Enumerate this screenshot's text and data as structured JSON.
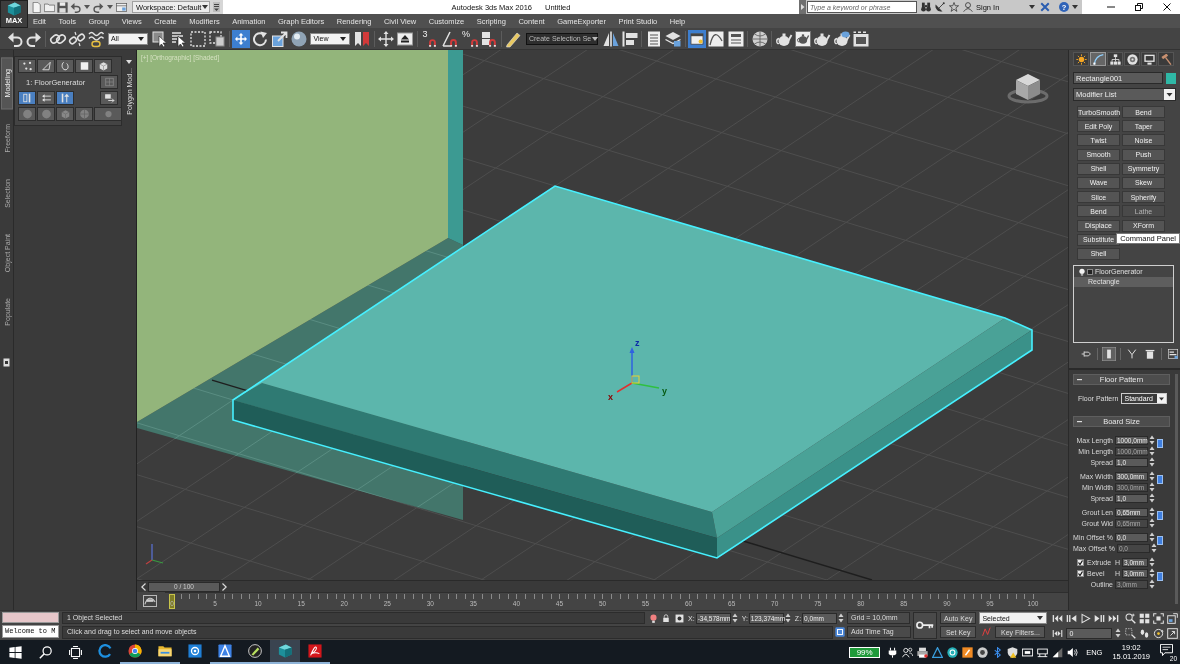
{
  "window": {
    "app_button": "MAX",
    "title": "Autodesk 3ds Max 2016",
    "document": "Untitled"
  },
  "quick_access": {
    "workspace": "Workspace: Default"
  },
  "info_center": {
    "search_placeholder": "Type a keyword or phrase",
    "sign_in": "Sign In",
    "help": "?"
  },
  "menu": [
    "Edit",
    "Tools",
    "Group",
    "Views",
    "Create",
    "Modifiers",
    "Animation",
    "Graph Editors",
    "Rendering",
    "Civil View",
    "Customize",
    "Scripting",
    "Content",
    "GameExporter",
    "Print Studio",
    "Help"
  ],
  "toolbar": [
    {
      "kind": "button",
      "selected": false
    },
    {
      "kind": "button",
      "selected": false
    },
    {
      "kind": "separator"
    },
    {
      "kind": "button",
      "selected": false
    },
    {
      "kind": "button",
      "selected": false
    },
    {
      "kind": "button",
      "selected": false
    },
    {
      "kind": "dropdown",
      "value": "All"
    },
    {
      "kind": "button",
      "selected": false
    },
    {
      "kind": "button",
      "selected": false
    },
    {
      "kind": "button",
      "selected": false
    },
    {
      "kind": "button",
      "selected": false
    },
    {
      "kind": "separator"
    },
    {
      "kind": "button",
      "selected": true
    },
    {
      "kind": "button",
      "selected": false
    },
    {
      "kind": "button",
      "selected": false
    },
    {
      "kind": "button",
      "selected": false
    },
    {
      "kind": "dropdown",
      "value": "View"
    },
    {
      "kind": "button",
      "selected": false
    },
    {
      "kind": "separator"
    },
    {
      "kind": "button",
      "selected": false
    },
    {
      "kind": "button",
      "selected": false
    },
    {
      "kind": "separator"
    },
    {
      "kind": "button",
      "selected": false,
      "label": "3"
    },
    {
      "kind": "button",
      "selected": false
    },
    {
      "kind": "button",
      "selected": false,
      "label": "%"
    },
    {
      "kind": "button",
      "selected": false
    },
    {
      "kind": "separator"
    },
    {
      "kind": "button",
      "selected": false
    },
    {
      "kind": "combo",
      "value": "Create Selection Se"
    },
    {
      "kind": "button",
      "selected": false
    },
    {
      "kind": "button",
      "selected": false
    },
    {
      "kind": "separator"
    },
    {
      "kind": "button",
      "selected": false
    },
    {
      "kind": "button",
      "selected": false
    },
    {
      "kind": "separator"
    },
    {
      "kind": "button",
      "selected": true
    },
    {
      "kind": "button",
      "selected": false
    },
    {
      "kind": "button",
      "selected": false
    },
    {
      "kind": "separator"
    },
    {
      "kind": "button",
      "selected": false
    },
    {
      "kind": "separator"
    },
    {
      "kind": "button",
      "selected": false
    },
    {
      "kind": "button",
      "selected": false
    },
    {
      "kind": "button",
      "selected": false
    },
    {
      "kind": "button",
      "selected": false
    },
    {
      "kind": "button",
      "selected": false
    }
  ],
  "ribbon": {
    "tabs": [
      {
        "label": "Modeling",
        "selected": true
      },
      {
        "label": "Freeform",
        "selected": false
      },
      {
        "label": "Selection",
        "selected": false
      },
      {
        "label": "Object Paint",
        "selected": false
      },
      {
        "label": "Populate",
        "selected": false
      }
    ],
    "subobject_levels": [
      {
        "selected": false
      },
      {
        "selected": false
      },
      {
        "selected": false
      },
      {
        "selected": false
      },
      {
        "selected": false
      }
    ],
    "object": "1: FloorGenerator",
    "tools": [
      {
        "selected": true
      },
      {
        "selected": false
      },
      {
        "selected": true
      }
    ],
    "side_tools": [
      {
        "disabled": true
      },
      {
        "disabled": false
      }
    ],
    "actions": [
      {
        "disabled": true
      },
      {
        "disabled": true
      },
      {
        "disabled": true
      },
      {
        "disabled": true
      },
      {
        "disabled": true
      }
    ],
    "panel_title": "Polygon Mod..."
  },
  "viewport": {
    "label": "[+] [Orthographic] [Shaded]",
    "gizmo_axes": [
      "z",
      "y",
      "x"
    ]
  },
  "command_panel": {
    "tabs": [
      {
        "selected": false
      },
      {
        "selected": true
      },
      {
        "selected": false
      },
      {
        "selected": false
      },
      {
        "selected": false
      },
      {
        "selected": false
      }
    ],
    "object_name": "Rectangle001",
    "modifier_list": "Modifier List",
    "modifier_rows": [
      [
        {
          "label": "TurboSmooth",
          "disabled": false
        },
        {
          "label": "Bend",
          "disabled": false
        }
      ],
      [
        {
          "label": "Edit Poly",
          "disabled": false
        },
        {
          "label": "Taper",
          "disabled": false
        }
      ],
      [
        {
          "label": "Twist",
          "disabled": false
        },
        {
          "label": "Noise",
          "disabled": false
        }
      ],
      [
        {
          "label": "Smooth",
          "disabled": false
        },
        {
          "label": "Push",
          "disabled": false
        }
      ],
      [
        {
          "label": "Shell",
          "disabled": false
        },
        {
          "label": "Symmetry",
          "disabled": false
        }
      ],
      [
        {
          "label": "Wave",
          "disabled": false
        },
        {
          "label": "Skew",
          "disabled": false
        }
      ],
      [
        {
          "label": "Slice",
          "disabled": false
        },
        {
          "label": "Spherify",
          "disabled": false
        }
      ],
      [
        {
          "label": "Bend",
          "disabled": false
        },
        {
          "label": "Lathe",
          "disabled": true
        }
      ],
      [
        {
          "label": "Displace",
          "disabled": false
        },
        {
          "label": "XForm",
          "disabled": false
        }
      ],
      [
        {
          "label": "Substitute",
          "disabled": false
        }
      ],
      [
        {
          "label": "Shell",
          "disabled": false
        }
      ]
    ],
    "tooltip": "Command Panel",
    "stack": [
      {
        "kind": "modifier",
        "label": "FloorGenerator",
        "selected": false,
        "on": true
      },
      {
        "kind": "object",
        "label": "Rectangle",
        "selected": true
      }
    ],
    "stack_tools": [
      {
        "selected": false
      },
      {
        "selected": true
      },
      {
        "selected": false
      },
      {
        "selected": false
      },
      {
        "selected": false
      }
    ],
    "floor_pattern": {
      "title": "Floor Pattern",
      "expanded": true,
      "label": "Floor Pattern",
      "value": "Standard"
    },
    "board_size": {
      "title": "Board Size",
      "expanded": true,
      "groups": [
        {
          "linked": true,
          "rows": [
            {
              "kind": "spinner",
              "label": "Max Length",
              "value": "1000,0mm",
              "disabled": false
            },
            {
              "kind": "spinner",
              "label": "Min Length",
              "value": "1000,0mm",
              "disabled": true
            },
            {
              "kind": "spinner",
              "label": "Spread",
              "value": "1,0",
              "disabled": false
            }
          ]
        },
        {
          "linked": true,
          "rows": [
            {
              "kind": "spinner",
              "label": "Max Width",
              "value": "300,0mm",
              "disabled": false
            },
            {
              "kind": "spinner",
              "label": "Min Width",
              "value": "300,0mm",
              "disabled": true
            },
            {
              "kind": "spinner",
              "label": "Spread",
              "value": "1,0",
              "disabled": false
            }
          ]
        },
        {
          "linked": true,
          "rows": [
            {
              "kind": "spinner",
              "label": "Grout Len",
              "value": "0,65mm",
              "disabled": false
            },
            {
              "kind": "spinner",
              "label": "Grout Wid",
              "value": "0,65mm",
              "disabled": true
            }
          ]
        },
        {
          "linked": true,
          "rows": [
            {
              "kind": "spinner",
              "label": "Min Offset %",
              "value": "0,0",
              "disabled": false
            },
            {
              "kind": "spinner",
              "label": "Max Offset %",
              "value": "0,0",
              "disabled": true
            }
          ]
        },
        {
          "linked": false,
          "rows": [
            {
              "kind": "check",
              "label": "Extrude",
              "axis": "H",
              "checked": true,
              "value": "3,0mm",
              "disabled": false
            }
          ]
        },
        {
          "linked": true,
          "rows": [
            {
              "kind": "check",
              "label": "Bevel",
              "axis": "H",
              "checked": true,
              "value": "3,0mm",
              "disabled": false
            },
            {
              "kind": "spinner",
              "label": "Outline",
              "value": "3,0mm",
              "disabled": true
            }
          ]
        }
      ]
    }
  },
  "timeline": {
    "position": "0 / 100",
    "level": 0,
    "ticks": [
      "0",
      "5",
      "10",
      "15",
      "20",
      "25",
      "30",
      "35",
      "40",
      "45",
      "50",
      "55",
      "60",
      "65",
      "70",
      "75",
      "80",
      "85",
      "90",
      "95",
      "100"
    ]
  },
  "status": {
    "listener_output": "Welcome to M",
    "prompt": "1 Object Selected",
    "hint": "Click and drag to select and move objects",
    "coords": [
      {
        "axis": "X:",
        "value": "-34,578mm"
      },
      {
        "axis": "Y:",
        "value": "123,374mm"
      },
      {
        "axis": "Z:",
        "value": "0,0mm"
      }
    ],
    "grid": "Grid = 10,0mm",
    "time_tag": "Add Time Tag",
    "auto_key": "Auto Key",
    "key_target": "Selected",
    "set_key": "Set Key",
    "key_filters": "Key Filters...",
    "frame": "0"
  },
  "taskbar": {
    "apps": [
      {
        "running": false,
        "selected": false
      },
      {
        "running": true,
        "selected": false
      },
      {
        "running": true,
        "selected": false
      },
      {
        "running": false,
        "selected": false
      },
      {
        "running": true,
        "selected": false
      },
      {
        "running": true,
        "selected": false
      },
      {
        "running": true,
        "selected": true
      },
      {
        "running": true,
        "selected": false
      }
    ],
    "battery": "99%",
    "language": "ENG",
    "time": "19:02",
    "date": "15.01.2019",
    "notifications": "20"
  }
}
